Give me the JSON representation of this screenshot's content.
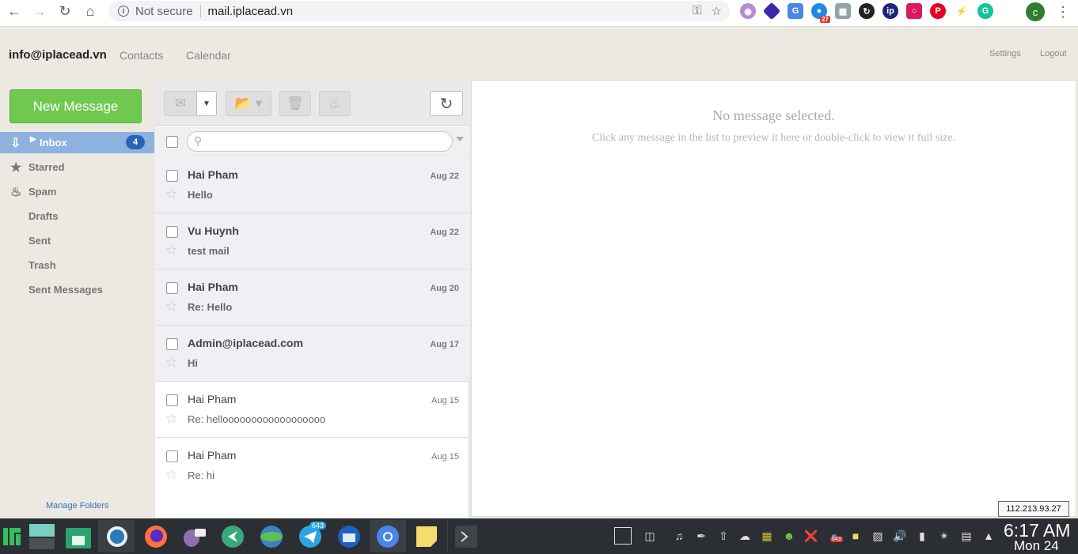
{
  "browser": {
    "security_label": "Not secure",
    "url": "mail.iplacead.vn",
    "profile_initial": "c",
    "extension_badge": "27"
  },
  "header": {
    "account": "info@iplacead.vn",
    "nav": [
      "Contacts",
      "Calendar"
    ],
    "settings": "Settings",
    "logout": "Logout"
  },
  "sidebar": {
    "new_message": "New Message",
    "folders": [
      {
        "label": "Inbox",
        "count": "4",
        "icon": "inbox-icon"
      },
      {
        "label": "Starred",
        "icon": "star-icon"
      },
      {
        "label": "Spam",
        "icon": "fire-icon"
      },
      {
        "label": "Drafts"
      },
      {
        "label": "Sent"
      },
      {
        "label": "Trash"
      },
      {
        "label": "Sent Messages"
      }
    ],
    "manage_folders": "Manage Folders"
  },
  "messages": [
    {
      "sender": "Hai Pham",
      "date": "Aug 22",
      "subject": "Hello",
      "unread": true
    },
    {
      "sender": "Vu Huynh",
      "date": "Aug 22",
      "subject": "test mail",
      "unread": true
    },
    {
      "sender": "Hai Pham",
      "date": "Aug 20",
      "subject": "Re: Hello",
      "unread": true
    },
    {
      "sender": "Admin@iplacead.com",
      "date": "Aug 17",
      "subject": "Hi",
      "unread": true
    },
    {
      "sender": "Hai Pham",
      "date": "Aug 15",
      "subject": "Re: helloooooooooooooooooo",
      "unread": false
    },
    {
      "sender": "Hai Pham",
      "date": "Aug 15",
      "subject": "Re: hi",
      "unread": false
    }
  ],
  "preview": {
    "title": "No message selected.",
    "hint": "Click any message in the list to preview it here or double-click to view it full size."
  },
  "ip_address": "112.213.93.27",
  "taskbar": {
    "telegram_badge": "643",
    "tray_badge": "643",
    "time": "6:17 AM",
    "date": "Mon 24"
  },
  "colors": {
    "accent_green": "#6fc94f",
    "inbox_active": "#8db2e0",
    "count_badge": "#2a64b8"
  }
}
